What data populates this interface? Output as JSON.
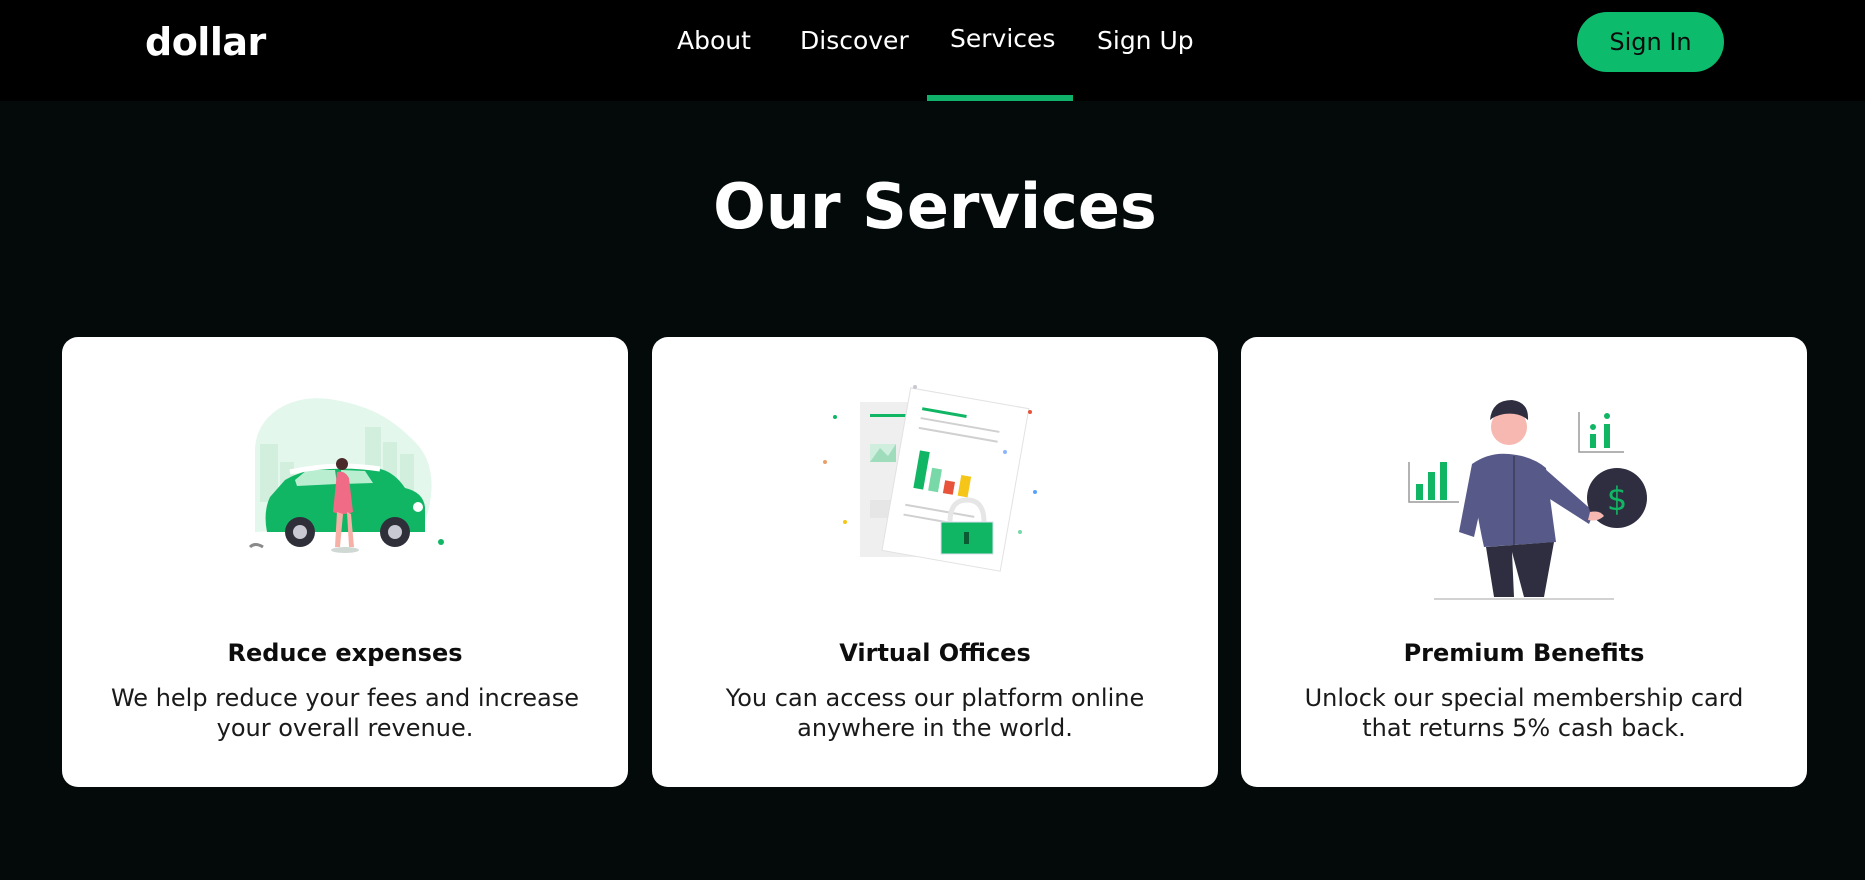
{
  "brand": {
    "logo": "dollar"
  },
  "nav": {
    "links": [
      {
        "label": "About"
      },
      {
        "label": "Discover"
      },
      {
        "label": "Services",
        "active": true
      },
      {
        "label": "Sign Up"
      }
    ],
    "signin_label": "Sign In"
  },
  "main": {
    "title": "Our Services",
    "cards": [
      {
        "title": "Reduce expenses",
        "description": "We help reduce your fees and increase your overall revenue.",
        "illustration": "woman-with-green-car"
      },
      {
        "title": "Virtual Offices",
        "description": "You can access our platform online anywhere in the world.",
        "illustration": "documents-with-chart-and-lock"
      },
      {
        "title": "Premium Benefits",
        "description": "Unlock our special membership card that returns 5% cash back.",
        "illustration": "man-with-dollar-coin"
      }
    ]
  },
  "colors": {
    "accent": "#0cbc6c",
    "page_background": "#040a0a",
    "navbar_background": "#000000",
    "card_background": "#ffffff",
    "illustration_purple": "#575a89"
  }
}
